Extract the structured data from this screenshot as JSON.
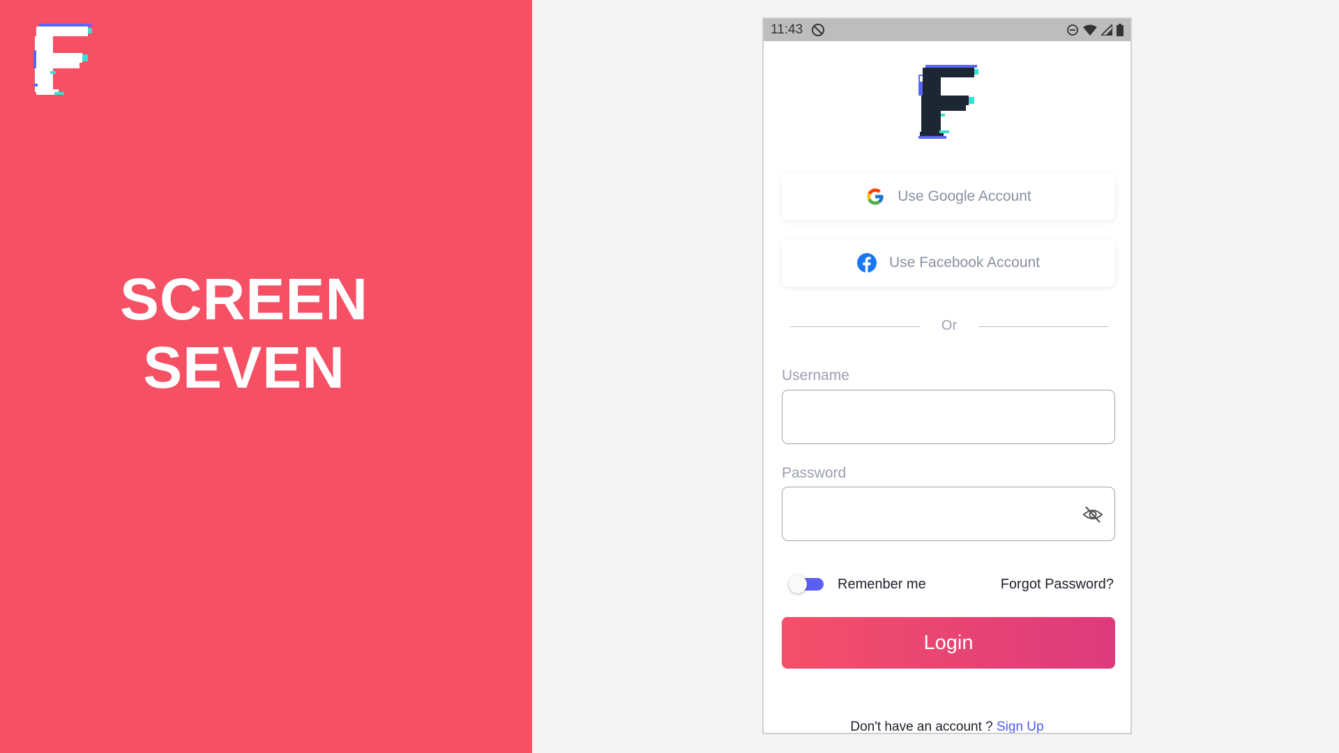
{
  "colors": {
    "left_panel": "#f65065",
    "accent": "#5a5ff0",
    "login_gradient": [
      "#f4506a",
      "#dc3a7c"
    ],
    "link": "#4a5af0",
    "logo_dark": "#1d2733",
    "logo_glitch": [
      "#36e0d4",
      "#5966f2"
    ]
  },
  "left_panel": {
    "logo_icon": "glitch-f-logo",
    "title_line1": "SCREEN",
    "title_line2": "SEVEN"
  },
  "status_bar": {
    "time": "11:43",
    "icons": [
      "at-sign-icon",
      "dnd-icon",
      "wifi-icon",
      "signal-icon",
      "battery-icon"
    ]
  },
  "login": {
    "logo_icon": "glitch-f-logo",
    "google_button": "Use Google Account",
    "facebook_button": "Use Facebook Account",
    "divider_text": "Or",
    "username_label": "Username",
    "username_value": "",
    "password_label": "Password",
    "password_value": "",
    "remember_label": "Remenber me",
    "remember_on": true,
    "forgot_link": "Forgot Password?",
    "login_button": "Login",
    "signup_prompt": "Don't have an account ?",
    "signup_link": "Sign Up"
  }
}
